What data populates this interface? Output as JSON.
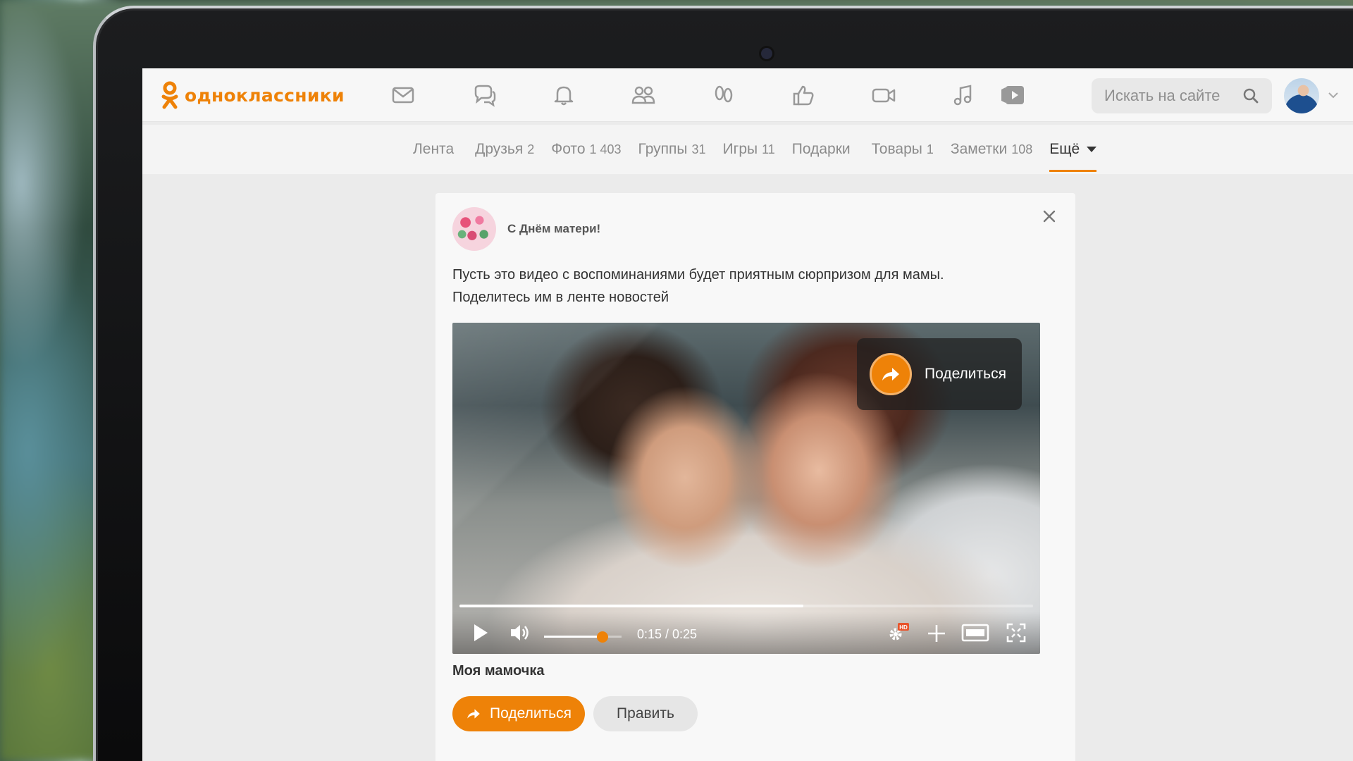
{
  "brand": {
    "name": "одноклассники",
    "accent": "#ee8208"
  },
  "header": {
    "nav_icons": [
      "mail-icon",
      "chat-icon",
      "bell-icon",
      "friends-icon",
      "footprints-icon",
      "like-icon",
      "video-camera-icon",
      "music-icon",
      "video-play-icon"
    ],
    "search": {
      "placeholder": "Искать на сайте"
    }
  },
  "subnav": {
    "items": [
      {
        "label": "Лента",
        "count": ""
      },
      {
        "label": "Друзья",
        "count": "2"
      },
      {
        "label": "Фото",
        "count": "1 403"
      },
      {
        "label": "Группы",
        "count": "31"
      },
      {
        "label": "Игры",
        "count": "11"
      },
      {
        "label": "Подарки",
        "count": ""
      },
      {
        "label": "Товары",
        "count": "1"
      },
      {
        "label": "Заметки",
        "count": "108"
      },
      {
        "label": "Ещё",
        "count": ""
      }
    ],
    "active": "Ещё"
  },
  "card": {
    "title": "С Днём матери!",
    "text_line1": "Пусть это видео с воспоминаниями будет приятным сюрпризом для мамы.",
    "text_line2": "Поделитесь им в ленте новостей",
    "video": {
      "share_overlay_label": "Поделиться",
      "time": "0:15 / 0:25",
      "progress": 0.6,
      "volume": 0.75,
      "quality_badge": "HD"
    },
    "video_title": "Моя мамочка",
    "share_button": "Поделиться",
    "edit_button": "Править"
  }
}
